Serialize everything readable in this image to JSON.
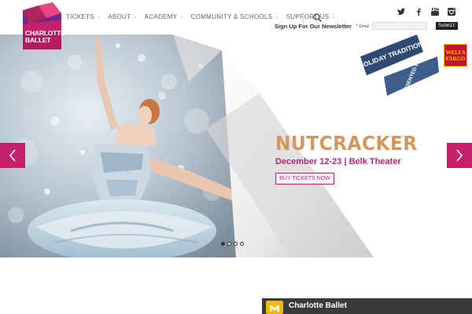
{
  "brand": {
    "logo_text": "CHARLOTTE BALLET",
    "colors": {
      "magenta": "#c4216b",
      "purple": "#6b2a8c",
      "gold": "#d4975a",
      "navy": "#2f4a73"
    }
  },
  "nav": {
    "items": [
      {
        "label": "TICKETS"
      },
      {
        "label": "ABOUT"
      },
      {
        "label": "ACADEMY"
      },
      {
        "label": "COMMUNITY & SCHOOLS"
      },
      {
        "label": "SUPPORT US"
      }
    ],
    "search_icon": "search-icon"
  },
  "social": [
    "twitter-icon",
    "facebook-icon",
    "youtube-icon",
    "instagram-icon"
  ],
  "newsletter": {
    "label": "Sign Up For Our Newsletter",
    "email_label": "* Email",
    "email_value": "",
    "submit_label": "Submit"
  },
  "hero": {
    "badge_line1": "A HOLIDAY TRADITION",
    "badge_line2": "PRESENTED BY",
    "sponsor": "WELLS FARGO",
    "title": "NUTCRACKER",
    "dates": "December 12-23 | Belk Theater",
    "cta": "BUY TICKETS NOW",
    "slides": 4,
    "active_slide": 1
  },
  "widget": {
    "title": "Charlotte Ballet"
  }
}
